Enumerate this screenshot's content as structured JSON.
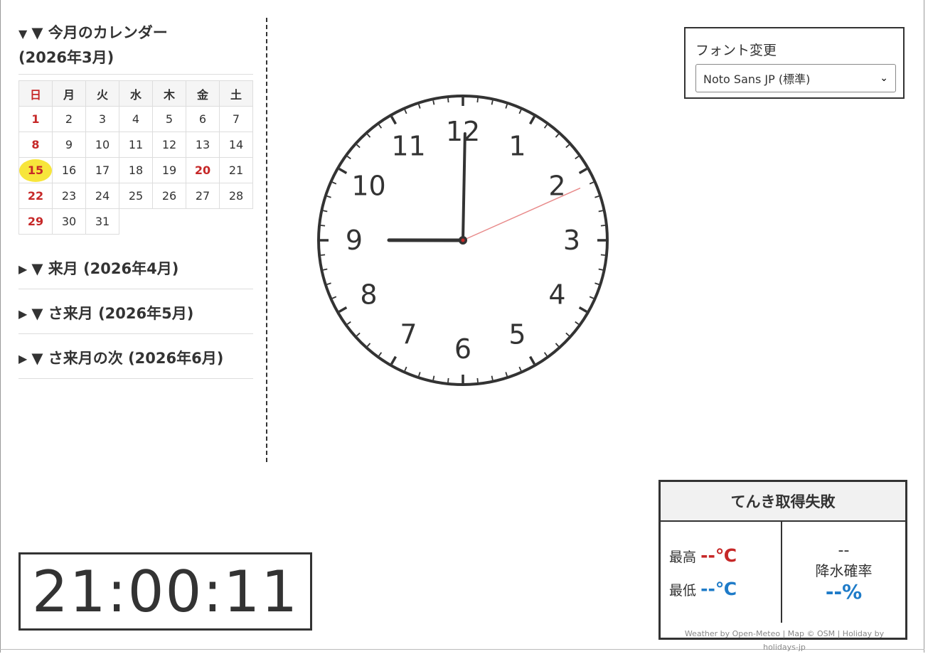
{
  "calendar": {
    "current": {
      "heading": "▼ 今月のカレンダー",
      "heading_sub": "(2026年3月)",
      "weekdays": [
        "日",
        "月",
        "火",
        "水",
        "木",
        "金",
        "土"
      ],
      "weeks": [
        [
          "1",
          "2",
          "3",
          "4",
          "5",
          "6",
          "7"
        ],
        [
          "8",
          "9",
          "10",
          "11",
          "12",
          "13",
          "14"
        ],
        [
          "15",
          "16",
          "17",
          "18",
          "19",
          "20",
          "21"
        ],
        [
          "22",
          "23",
          "24",
          "25",
          "26",
          "27",
          "28"
        ],
        [
          "29",
          "30",
          "31",
          "",
          "",
          "",
          ""
        ]
      ],
      "today": "15",
      "holidays": [
        "20"
      ]
    },
    "next": "▼ 来月 (2026年4月)",
    "after_next": "▼ さ来月 (2026年5月)",
    "after_after_next": "▼ さ来月の次 (2026年6月)"
  },
  "font_selector": {
    "label": "フォント変更",
    "selected": "Noto Sans JP (標準)"
  },
  "clock": {
    "numerals": [
      "12",
      "1",
      "2",
      "3",
      "4",
      "5",
      "6",
      "7",
      "8",
      "9",
      "10",
      "11"
    ],
    "time": {
      "hours": 21,
      "minutes": 0,
      "seconds": 11
    }
  },
  "digital_clock": "21:00:11",
  "weather": {
    "title": "てんき取得失敗",
    "high_label": "最高",
    "high_value": "--℃",
    "low_label": "最低",
    "low_value": "--℃",
    "precip_top": "--",
    "precip_label": "降水確率",
    "precip_value": "--%",
    "credit": "Weather by Open-Meteo | Map © OSM | Holiday by holidays-jp"
  },
  "colors": {
    "sunday": "#c62828",
    "today_highlight": "#f7e53b",
    "low_temp": "#1e7bc8",
    "second_hand": "#e88a8a"
  }
}
